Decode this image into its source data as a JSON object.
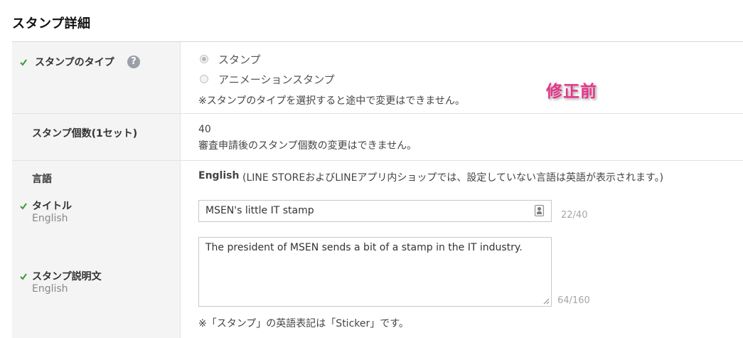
{
  "page_title": "スタンプ詳細",
  "rows": {
    "type": {
      "label": "スタンプのタイプ",
      "help": "?",
      "options": [
        {
          "label": "スタンプ",
          "checked": true
        },
        {
          "label": "アニメーションスタンプ",
          "checked": false
        }
      ],
      "note": "※スタンプのタイプを選択すると途中で変更はできません。"
    },
    "count": {
      "label": "スタンプ個数(1セット)",
      "value": "40",
      "note": "審査申請後のスタンプ個数の変更はできません。"
    },
    "language": {
      "label": "言語",
      "value": "English",
      "note": "(LINE STOREおよびLINEアプリ内ショップでは、設定していない言語は英語が表示されます。)"
    },
    "title": {
      "label": "タイトル",
      "sub": "English",
      "value": "MSEN's little IT stamp",
      "counter": "22/40"
    },
    "description": {
      "label": "スタンプ説明文",
      "sub": "English",
      "value": "The president of MSEN sends a bit of a stamp in the IT industry.",
      "counter": "64/160",
      "note": "※「スタンプ」の英語表記は「Sticker」です。"
    }
  },
  "annotation": "修正前",
  "icons": {
    "required": "check-icon",
    "help": "help-icon",
    "contact_card": "contact-card-icon",
    "resize": "resize-handle-icon"
  },
  "colors": {
    "check": "#3a9a32",
    "annotation": "#e8338a",
    "label_bg": "#f4f4f4"
  }
}
